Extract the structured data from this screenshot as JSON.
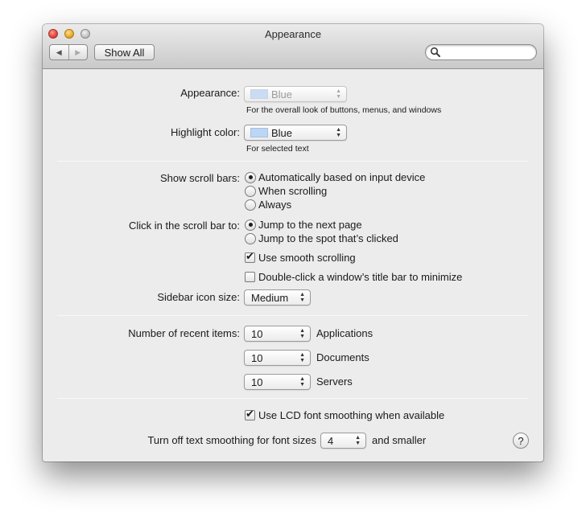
{
  "window": {
    "title": "Appearance"
  },
  "toolbar": {
    "back_glyph": "◀",
    "forward_glyph": "▶",
    "show_all_label": "Show All",
    "search_placeholder": "",
    "search_value": ""
  },
  "appearance": {
    "label": "Appearance:",
    "value": "Blue",
    "hint": "For the overall look of buttons, menus, and windows"
  },
  "highlight": {
    "label": "Highlight color:",
    "value": "Blue",
    "hint": "For selected text"
  },
  "scroll_bars": {
    "label": "Show scroll bars:",
    "options": [
      {
        "label": "Automatically based on input device",
        "selected": true
      },
      {
        "label": "When scrolling",
        "selected": false
      },
      {
        "label": "Always",
        "selected": false
      }
    ]
  },
  "scroll_click": {
    "label": "Click in the scroll bar to:",
    "options": [
      {
        "label": "Jump to the next page",
        "selected": true
      },
      {
        "label": "Jump to the spot that’s clicked",
        "selected": false
      }
    ]
  },
  "checkboxes": {
    "smooth_scrolling": {
      "label": "Use smooth scrolling",
      "checked": true
    },
    "double_click_minimize": {
      "label": "Double-click a window’s title bar to minimize",
      "checked": false
    },
    "lcd_smoothing": {
      "label": "Use LCD font smoothing when available",
      "checked": true
    }
  },
  "sidebar_icon_size": {
    "label": "Sidebar icon size:",
    "value": "Medium"
  },
  "recent_items": {
    "label": "Number of recent items:",
    "rows": [
      {
        "value": "10",
        "kind": "Applications"
      },
      {
        "value": "10",
        "kind": "Documents"
      },
      {
        "value": "10",
        "kind": "Servers"
      }
    ]
  },
  "text_smoothing": {
    "prefix": "Turn off text smoothing for font sizes",
    "value": "4",
    "suffix": "and smaller"
  },
  "help": {
    "glyph": "?"
  },
  "colors": {
    "title_bar_top": "#ebebeb",
    "title_bar_bottom": "#c9c9c9",
    "panel_bg": "#ececec",
    "close": "#e0443a",
    "minimize": "#e9a82a",
    "zoom": "#c4c4c4",
    "color_swatch": "#bcd6f6"
  }
}
